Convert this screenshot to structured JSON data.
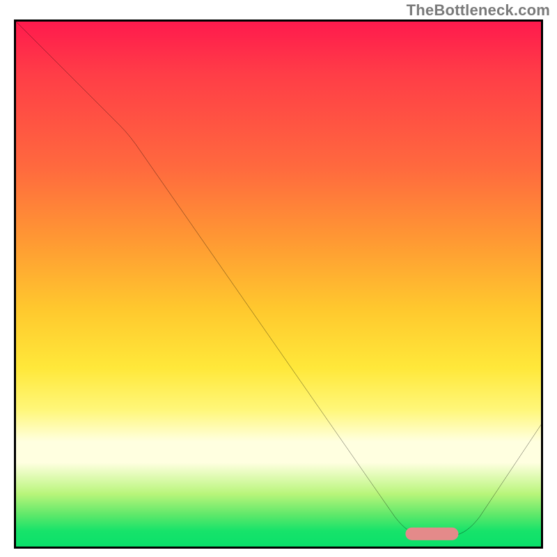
{
  "watermark": "TheBottleneck.com",
  "colors": {
    "curve": "#000000",
    "marker": "#e48a8a",
    "gradient_top": "#ff1a4d",
    "gradient_bottom": "#0ae06a"
  },
  "chart_data": {
    "type": "line",
    "title": "",
    "xlabel": "",
    "ylabel": "",
    "xlim": [
      0,
      100
    ],
    "ylim": [
      0,
      100
    ],
    "note": "x = relative hardware balance position (0–100, unlabeled). y = bottleneck % (0 at bottom = no bottleneck, 100 at top). Background gradient encodes y: red≈100 → green≈0. Values estimated from pixel positions.",
    "series": [
      {
        "name": "bottleneck-curve",
        "x": [
          0,
          10,
          20,
          24,
          30,
          40,
          50,
          60,
          70,
          74,
          78,
          80,
          82,
          86,
          90,
          95,
          100
        ],
        "y": [
          100,
          90,
          80,
          75,
          66,
          53,
          39,
          26,
          10,
          4,
          2,
          2,
          2,
          4,
          9,
          17,
          24
        ]
      }
    ],
    "annotations": [
      {
        "name": "optimum-range",
        "shape": "bar",
        "x_start": 74,
        "x_end": 84,
        "y": 2,
        "color": "#e48a8a"
      }
    ]
  }
}
